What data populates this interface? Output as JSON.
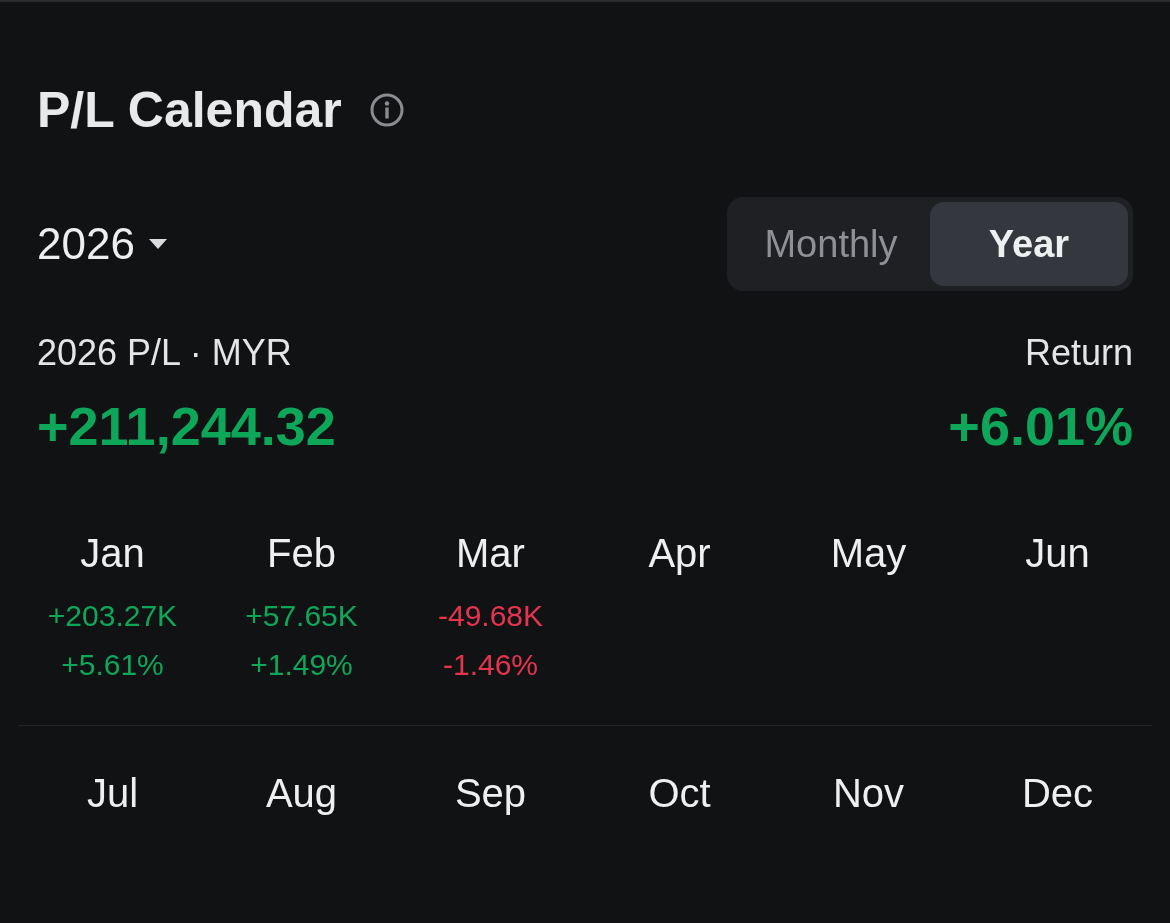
{
  "header": {
    "title": "P/L Calendar"
  },
  "year_selector": {
    "value": "2026"
  },
  "view_toggle": [
    {
      "label": "Monthly",
      "selected": false
    },
    {
      "label": "Year",
      "selected": true
    }
  ],
  "summary": {
    "label": "2026 P/L · MYR",
    "value": "+211,244.32",
    "return_label": "Return",
    "return_value": "+6.01%"
  },
  "months": [
    {
      "name": "Jan",
      "pl": "+203.27K",
      "return": "+5.61%",
      "color": "#0ea75a"
    },
    {
      "name": "Feb",
      "pl": "+57.65K",
      "return": "+1.49%",
      "color": "#0ea75a"
    },
    {
      "name": "Mar",
      "pl": "-49.68K",
      "return": "-1.46%",
      "color": "#e6344f"
    },
    {
      "name": "Apr"
    },
    {
      "name": "May"
    },
    {
      "name": "Jun"
    },
    {
      "name": "Jul"
    },
    {
      "name": "Aug"
    },
    {
      "name": "Sep"
    },
    {
      "name": "Oct"
    },
    {
      "name": "Nov"
    },
    {
      "name": "Dec"
    }
  ]
}
